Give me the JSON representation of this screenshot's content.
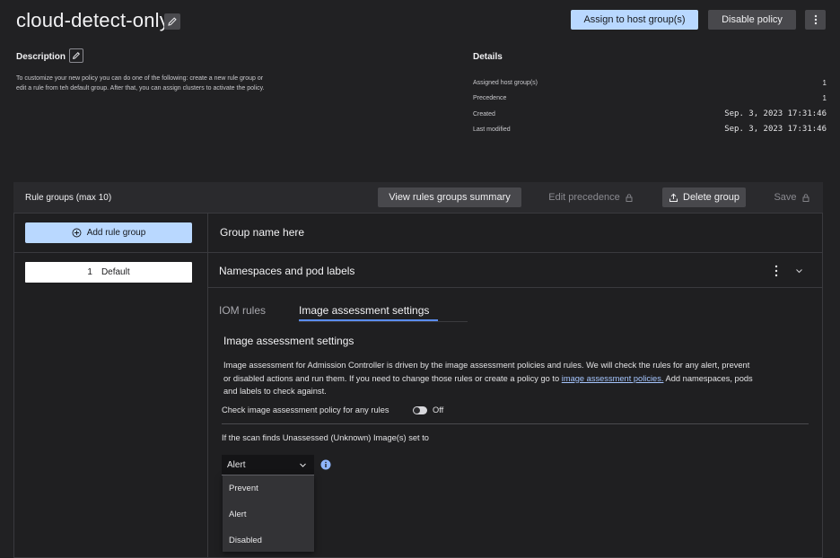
{
  "header": {
    "title": "cloud-detect-only",
    "assign_label": "Assign to host group(s)",
    "disable_label": "Disable policy"
  },
  "description": {
    "heading": "Description",
    "text_line1": "To customize your new policy you can do one of the following: create a new rule group or",
    "text_line2": "edit a rule from teh default group. After that, you can assign clusters to activate the policy."
  },
  "details": {
    "heading": "Details",
    "rows": [
      {
        "key": "Assigned host group(s)",
        "value": "1"
      },
      {
        "key": "Precedence",
        "value": "1"
      },
      {
        "key": "Created",
        "value": "Sep. 3, 2023 17:31:46"
      },
      {
        "key": "Last modified",
        "value": "Sep. 3, 2023 17:31:46"
      }
    ]
  },
  "rule_groups": {
    "title": "Rule groups (max 10)",
    "view_summary_label": "View rules groups summary",
    "edit_precedence_label": "Edit precedence",
    "delete_label": "Delete group",
    "save_label": "Save",
    "add_label": "Add rule group",
    "items": [
      {
        "number": "1",
        "name": "Default"
      }
    ]
  },
  "group": {
    "name": "Group name here",
    "section_title": "Namespaces and pod labels",
    "tabs": [
      "IOM rules",
      "Image assessment settings"
    ],
    "active_tab": "Image assessment settings"
  },
  "image_assessment": {
    "heading": "Image assessment settings",
    "para_line1": "Image assessment for Admission Controller is driven by the image assessment policies and rules. We will check the rules for any alert, prevent",
    "para_line2_pre": "or disabled actions and run them. If you need to change those rules or create a policy go to ",
    "para_link": "image assessment policies.",
    "para_line2_post": " Add namespaces, pods",
    "para_line3": "and labels to check against.",
    "check_label": "Check image assessment policy for any rules",
    "toggle_state": "Off",
    "unassessed_label": "If the scan finds Unassessed (Unknown) Image(s) set to",
    "select_value": "Alert",
    "options": [
      "Prevent",
      "Alert",
      "Disabled"
    ]
  },
  "colors": {
    "background": "#212123",
    "primary_button": "#b9d8ff",
    "tab_underline": "#5b8def",
    "link": "#a6c6ff",
    "info_icon": "#8fb5ff"
  }
}
